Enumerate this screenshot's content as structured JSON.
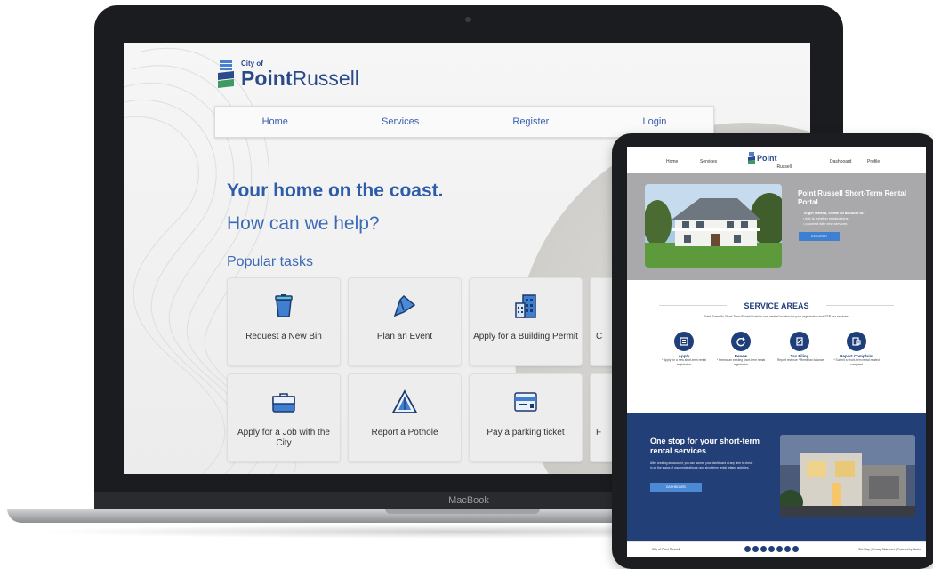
{
  "laptop": {
    "brand": "MacBook",
    "site": {
      "logo": {
        "city_of": "City of",
        "name_bold": "Point",
        "name_rest": "Russell"
      },
      "nav": [
        "Home",
        "Services",
        "Register",
        "Login"
      ],
      "hero_title": "Your home on the coast.",
      "hero_subtitle": "How can we help?",
      "popular_tasks_heading": "Popular tasks",
      "tasks": [
        {
          "label": "Request a New Bin",
          "icon": "bin-icon"
        },
        {
          "label": "Plan an Event",
          "icon": "pen-icon"
        },
        {
          "label": "Apply for a Building Permit",
          "icon": "building-icon"
        },
        {
          "label": "C",
          "icon": "partial-task-icon"
        },
        {
          "label": "Apply for a Job with the City",
          "icon": "briefcase-icon"
        },
        {
          "label": "Report a Pothole",
          "icon": "warning-triangle-icon"
        },
        {
          "label": "Pay a parking ticket",
          "icon": "ticket-card-icon"
        },
        {
          "label": "F",
          "icon": "partial-task-icon"
        }
      ]
    }
  },
  "tablet": {
    "nav": {
      "home": "Home",
      "services": "Services",
      "dashboard": "Dashboard",
      "profile": "Profile"
    },
    "logo": {
      "city_of": "City of",
      "name_bold": "Point",
      "name_rest": "Russell"
    },
    "hero": {
      "title": "Point Russell Short-Term Rental Portal",
      "intro": "To get started, create an account to:",
      "bullets": [
        "link to existing registrations",
        "proceed with new services"
      ],
      "button": "REGISTER"
    },
    "service_areas": {
      "title": "SERVICE AREAS",
      "description": "Point Russell's Short-Term Rental Portal is one central location for your registration and STR tax services.",
      "items": [
        {
          "name": "Apply",
          "text": "* Apply for a new short-term rental registration",
          "icon": "apply-icon"
        },
        {
          "name": "Renew",
          "text": "* Renew an existing short-term rental registration",
          "icon": "renew-icon"
        },
        {
          "name": "Tax Filing",
          "text": "* Report revenue * Remit tax balance",
          "icon": "tax-filing-icon"
        },
        {
          "name": "Report Complaint",
          "text": "* Submit a short-term rental related complaint",
          "icon": "complaint-icon"
        }
      ]
    },
    "promo": {
      "title": "One stop for your short-term rental services",
      "text": "After creating an account, you can access your dashboard at any time to check in on the status of your registration(s) and short-term rental related activities.",
      "button": "DASHBOARD"
    },
    "footer": {
      "left": "City of Point Russell",
      "right": "Site Map | Privacy Statement | Powered by Bizzlo"
    }
  },
  "colors": {
    "brand_blue": "#2d5ca8",
    "navy": "#233f78",
    "button_blue": "#3d7fd0"
  }
}
